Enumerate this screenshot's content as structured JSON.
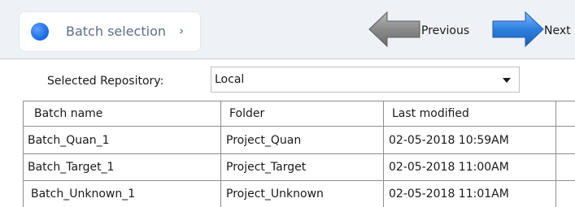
{
  "wizard": {
    "step": {
      "label": "Batch selection",
      "chevron": "›"
    },
    "previous_label": "Previous",
    "next_label": "Next",
    "accent_color": "#1f6fe6",
    "previous_arrow_color": "#7f7f7f",
    "next_arrow_color": "#2e7fe0"
  },
  "repository": {
    "label": "Selected Repository:",
    "value": "Local"
  },
  "table": {
    "columns": [
      "Batch name",
      "Folder",
      "Last modified"
    ],
    "rows": [
      [
        "Batch_Quan_1",
        "Project_Quan",
        "02-05-2018 10:59AM"
      ],
      [
        "Batch_Target_1",
        "Project_Target",
        "02-05-2018 11:00AM"
      ],
      [
        "Batch_Unknown_1",
        "Project_Unknown",
        "02-05-2018 11:01AM"
      ]
    ]
  }
}
